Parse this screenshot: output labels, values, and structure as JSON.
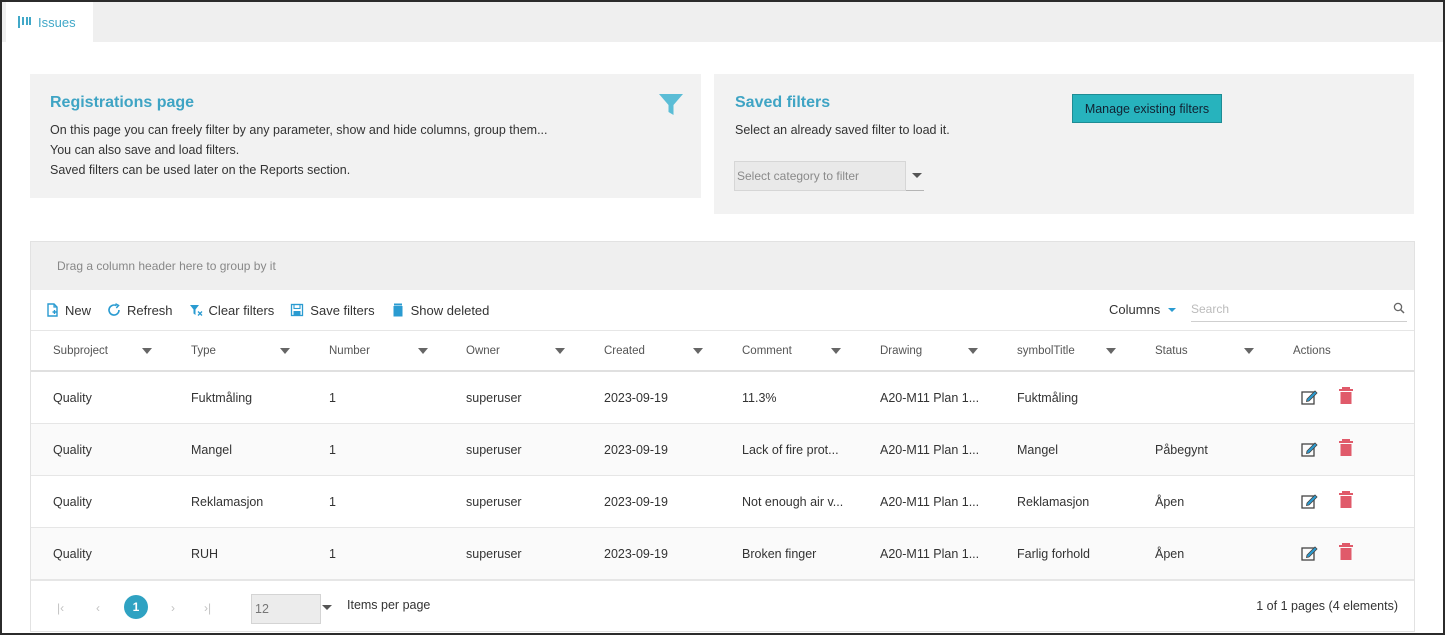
{
  "tabs": [
    {
      "label": "Issues",
      "icon": "issues-icon"
    }
  ],
  "info_panel": {
    "title": "Registrations page",
    "lines": [
      "On this page you can freely filter by any parameter, show and hide columns, group them...",
      "You can also save and load filters.",
      "Saved filters can be used later on the Reports section."
    ],
    "icon": "filter-icon"
  },
  "saved_filters": {
    "title": "Saved filters",
    "subtitle": "Select an already saved filter to load it.",
    "manage_label": "Manage existing filters",
    "select_placeholder": "Select category to filter"
  },
  "grid": {
    "group_hint": "Drag a column header here to group by it",
    "toolbar": {
      "new_label": "New",
      "refresh_label": "Refresh",
      "clear_label": "Clear filters",
      "save_label": "Save filters",
      "deleted_label": "Show deleted",
      "columns_label": "Columns",
      "search_placeholder": "Search"
    },
    "columns": [
      "Subproject",
      "Type",
      "Number",
      "Owner",
      "Created",
      "Comment",
      "Drawing",
      "symbolTitle",
      "Status",
      "Actions"
    ],
    "rows": [
      [
        "Quality",
        "Fuktmåling",
        "1",
        "superuser",
        "2023-09-19",
        "11.3%",
        "A20-M11 Plan 1...",
        "Fuktmåling",
        ""
      ],
      [
        "Quality",
        "Mangel",
        "1",
        "superuser",
        "2023-09-19",
        "Lack of fire prot...",
        "A20-M11 Plan 1...",
        "Mangel",
        "Påbegynt"
      ],
      [
        "Quality",
        "Reklamasjon",
        "1",
        "superuser",
        "2023-09-19",
        "Not enough air v...",
        "A20-M11 Plan 1...",
        "Reklamasjon",
        "Åpen"
      ],
      [
        "Quality",
        "RUH",
        "1",
        "superuser",
        "2023-09-19",
        "Broken finger",
        "A20-M11 Plan 1...",
        "Farlig forhold",
        "Åpen"
      ]
    ],
    "pager": {
      "first": "|‹",
      "prev": "‹",
      "current_page": "1",
      "next": "›",
      "last": "›|",
      "page_size": "12",
      "items_label": "Items per page",
      "info": "1 of 1 pages (4 elements)"
    }
  },
  "colors": {
    "accent": "#3fa4c4",
    "button": "#27b3bd",
    "delete": "#e05a6a",
    "edit": "#444444"
  }
}
